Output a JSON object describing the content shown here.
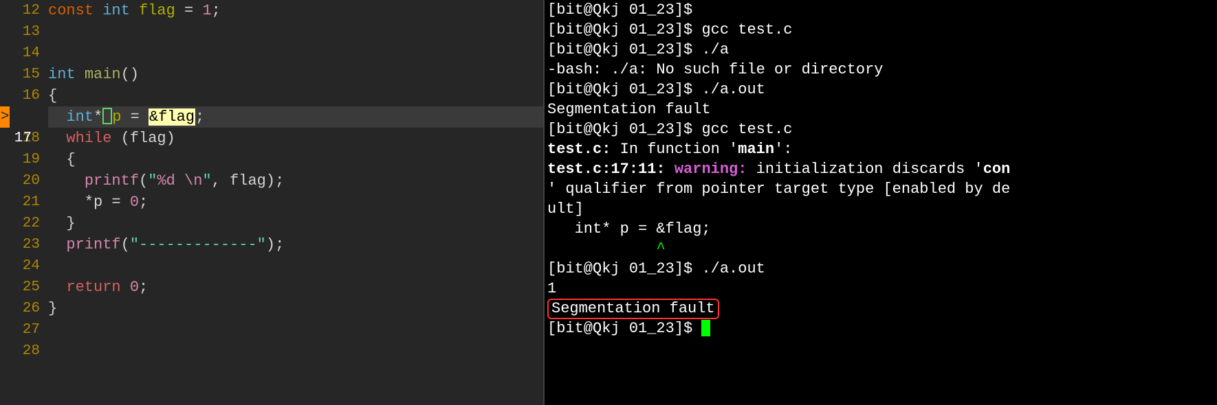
{
  "editor": {
    "lines": [
      {
        "n": "12",
        "tokens": [
          [
            "const ",
            "kw-const"
          ],
          [
            "int ",
            "kw-int"
          ],
          [
            "flag ",
            "kw-ident"
          ],
          [
            "= ",
            ""
          ],
          [
            "1",
            "kw-num"
          ],
          [
            ";",
            ""
          ]
        ]
      },
      {
        "n": "13",
        "tokens": []
      },
      {
        "n": "14",
        "tokens": []
      },
      {
        "n": "15",
        "tokens": [
          [
            "int ",
            "kw-int"
          ],
          [
            "main",
            "kw-main"
          ],
          [
            "()",
            "kw-brace"
          ]
        ]
      },
      {
        "n": "16",
        "tokens": [
          [
            "{",
            "kw-brace"
          ]
        ]
      },
      {
        "n": "17",
        "current": true,
        "marker": ">",
        "tokens": [
          [
            "  ",
            ""
          ],
          [
            "int",
            "kw-int"
          ],
          [
            "*",
            ""
          ],
          [
            " ",
            "cursor"
          ],
          [
            "p ",
            "kw-ident"
          ],
          [
            "= ",
            ""
          ],
          [
            "&flag",
            "hl-box"
          ],
          [
            ";",
            ""
          ]
        ]
      },
      {
        "n": "18",
        "tokens": [
          [
            "  ",
            ""
          ],
          [
            "while ",
            "kw-while"
          ],
          [
            "(flag)",
            ""
          ]
        ]
      },
      {
        "n": "19",
        "tokens": [
          [
            "  {",
            "kw-brace"
          ]
        ]
      },
      {
        "n": "20",
        "tokens": [
          [
            "    ",
            ""
          ],
          [
            "printf",
            "kw-printf"
          ],
          [
            "(",
            ""
          ],
          [
            "\"",
            "kw-str"
          ],
          [
            "%d \\n",
            "kw-esc"
          ],
          [
            "\"",
            "kw-str"
          ],
          [
            ", flag);",
            ""
          ]
        ]
      },
      {
        "n": "21",
        "tokens": [
          [
            "    *p = ",
            ""
          ],
          [
            "0",
            "kw-num"
          ],
          [
            ";",
            ""
          ]
        ]
      },
      {
        "n": "22",
        "tokens": [
          [
            "  }",
            "kw-brace"
          ]
        ]
      },
      {
        "n": "23",
        "tokens": [
          [
            "  ",
            ""
          ],
          [
            "printf",
            "kw-printf"
          ],
          [
            "(",
            ""
          ],
          [
            "\"-------------\"",
            "kw-str"
          ],
          [
            ");",
            ""
          ]
        ]
      },
      {
        "n": "24",
        "tokens": []
      },
      {
        "n": "25",
        "tokens": [
          [
            "  ",
            ""
          ],
          [
            "return ",
            "kw-return"
          ],
          [
            "0",
            "kw-num"
          ],
          [
            ";",
            ""
          ]
        ]
      },
      {
        "n": "26",
        "tokens": [
          [
            "}",
            "kw-brace"
          ]
        ]
      },
      {
        "n": "27",
        "tokens": []
      },
      {
        "n": "28",
        "tokens": []
      }
    ]
  },
  "terminal": {
    "lines": [
      {
        "segs": [
          [
            "[bit@Qkj 01_23]$ ",
            "term-prompt"
          ]
        ]
      },
      {
        "segs": [
          [
            "[bit@Qkj 01_23]$ ",
            "term-prompt"
          ],
          [
            "gcc test.c",
            ""
          ]
        ]
      },
      {
        "segs": [
          [
            "[bit@Qkj 01_23]$ ",
            "term-prompt"
          ],
          [
            "./a",
            ""
          ]
        ]
      },
      {
        "segs": [
          [
            "-bash: ./a: No such file or directory",
            ""
          ]
        ]
      },
      {
        "segs": [
          [
            "[bit@Qkj 01_23]$ ",
            "term-prompt"
          ],
          [
            "./a.out",
            ""
          ]
        ]
      },
      {
        "segs": [
          [
            "Segmentation fault",
            ""
          ]
        ]
      },
      {
        "segs": [
          [
            "[bit@Qkj 01_23]$ ",
            "term-prompt"
          ],
          [
            "gcc test.c",
            ""
          ]
        ]
      },
      {
        "segs": [
          [
            "test.c:",
            "term-bold"
          ],
          [
            " In function '",
            ""
          ],
          [
            "main",
            "term-bold"
          ],
          [
            "':",
            ""
          ]
        ]
      },
      {
        "segs": [
          [
            "test.c:17:11: ",
            "term-bold"
          ],
          [
            "warning:",
            "term-warn"
          ],
          [
            " initialization discards '",
            ""
          ],
          [
            "con",
            "term-bold"
          ]
        ]
      },
      {
        "segs": [
          [
            "' qualifier from pointer target type [enabled by de",
            ""
          ]
        ]
      },
      {
        "segs": [
          [
            "ult]",
            ""
          ]
        ]
      },
      {
        "segs": [
          [
            "   int* p = &flag;",
            ""
          ]
        ]
      },
      {
        "segs": [
          [
            "            ",
            ""
          ],
          [
            "^",
            "term-green"
          ]
        ]
      },
      {
        "segs": [
          [
            "[bit@Qkj 01_23]$ ",
            "term-prompt"
          ],
          [
            "./a.out",
            ""
          ]
        ]
      },
      {
        "segs": [
          [
            "1",
            ""
          ]
        ]
      },
      {
        "boxed": true,
        "segs": [
          [
            "Segmentation fault",
            ""
          ]
        ]
      },
      {
        "segs": [
          [
            "[bit@Qkj 01_23]$ ",
            "term-prompt"
          ],
          [
            "█",
            "term-cursor-block"
          ]
        ]
      }
    ]
  }
}
